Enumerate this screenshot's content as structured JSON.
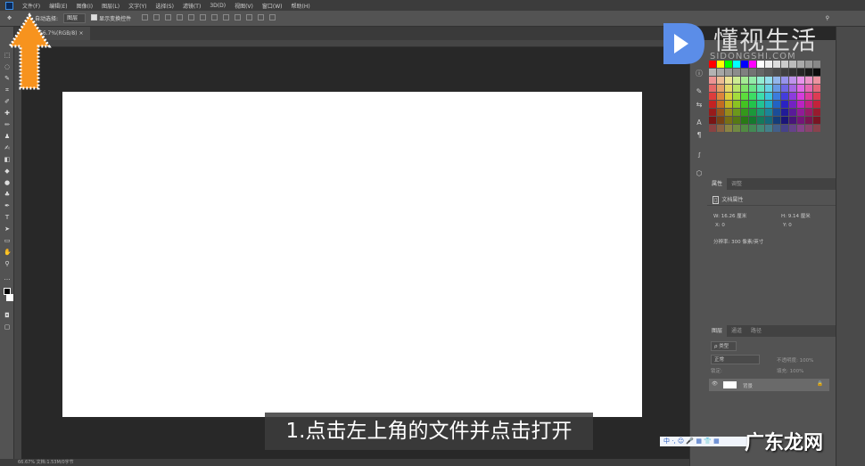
{
  "menu": [
    "文件(F)",
    "编辑(E)",
    "图像(I)",
    "图层(L)",
    "文字(Y)",
    "选择(S)",
    "滤镜(T)",
    "3D(D)",
    "视图(V)",
    "窗口(W)",
    "帮助(H)"
  ],
  "options": {
    "auto_select_label": "自动选择:",
    "auto_select_value": "图层",
    "show_transform": "显示变换控件"
  },
  "doc_tab": "66.7%(RGB/8)",
  "doc_tab_close": "×",
  "status": "66.67%    文档:1.53M/0字节",
  "properties": {
    "tabs": [
      "属性",
      "调整"
    ],
    "title": "文档属性",
    "w": "W: 16.26 厘米",
    "h": "H: 9.14 厘米",
    "x": "X: 0",
    "y": "Y: 0",
    "resolution": "分辨率: 300 像素/英寸"
  },
  "layers": {
    "tabs": [
      "图层",
      "通道",
      "路径"
    ],
    "kind": "ρ 类型",
    "blend": "正常",
    "opacity": "不透明度: 100%",
    "lock": "锁定:",
    "fill": "填充: 100%",
    "layer_name": "背景"
  },
  "subtitle": "1.点击左上角的文件并点击打开",
  "watermark": {
    "logo": "懂视生活",
    "logo_sub": "SIDONGSHI.COM",
    "site": "广东龙网"
  },
  "ime": "中 ·, ☺ 🎤 ▦ 👕 ▦",
  "colors": {
    "accent": "#f7931e",
    "doc": "#ffffff",
    "panel": "#535353"
  }
}
